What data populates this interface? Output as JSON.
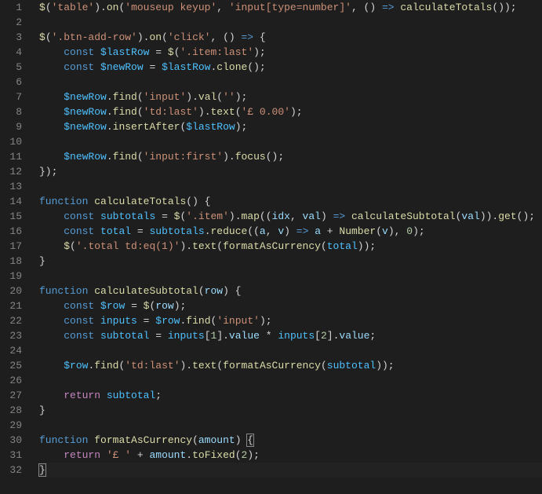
{
  "lines": [
    {
      "n": 1,
      "tokens": [
        {
          "t": "$",
          "c": "tok-call"
        },
        {
          "t": "(",
          "c": "tok-punc"
        },
        {
          "t": "'table'",
          "c": "tok-str"
        },
        {
          "t": ").",
          "c": "tok-punc"
        },
        {
          "t": "on",
          "c": "tok-call"
        },
        {
          "t": "(",
          "c": "tok-punc"
        },
        {
          "t": "'mouseup keyup'",
          "c": "tok-str"
        },
        {
          "t": ", ",
          "c": "tok-punc"
        },
        {
          "t": "'input[type=number]'",
          "c": "tok-str"
        },
        {
          "t": ", () ",
          "c": "tok-punc"
        },
        {
          "t": "=>",
          "c": "tok-kw"
        },
        {
          "t": " ",
          "c": "tok-punc"
        },
        {
          "t": "calculateTotals",
          "c": "tok-call"
        },
        {
          "t": "());",
          "c": "tok-punc"
        }
      ]
    },
    {
      "n": 2,
      "tokens": []
    },
    {
      "n": 3,
      "tokens": [
        {
          "t": "$",
          "c": "tok-call"
        },
        {
          "t": "(",
          "c": "tok-punc"
        },
        {
          "t": "'.btn-add-row'",
          "c": "tok-str"
        },
        {
          "t": ").",
          "c": "tok-punc"
        },
        {
          "t": "on",
          "c": "tok-call"
        },
        {
          "t": "(",
          "c": "tok-punc"
        },
        {
          "t": "'click'",
          "c": "tok-str"
        },
        {
          "t": ", () ",
          "c": "tok-punc"
        },
        {
          "t": "=>",
          "c": "tok-kw"
        },
        {
          "t": " {",
          "c": "tok-punc"
        }
      ]
    },
    {
      "n": 4,
      "tokens": [
        {
          "t": "    ",
          "c": "tok-punc"
        },
        {
          "t": "const",
          "c": "tok-kw"
        },
        {
          "t": " ",
          "c": "tok-punc"
        },
        {
          "t": "$lastRow",
          "c": "tok-const"
        },
        {
          "t": " = ",
          "c": "tok-punc"
        },
        {
          "t": "$",
          "c": "tok-call"
        },
        {
          "t": "(",
          "c": "tok-punc"
        },
        {
          "t": "'.item:last'",
          "c": "tok-str"
        },
        {
          "t": ");",
          "c": "tok-punc"
        }
      ]
    },
    {
      "n": 5,
      "tokens": [
        {
          "t": "    ",
          "c": "tok-punc"
        },
        {
          "t": "const",
          "c": "tok-kw"
        },
        {
          "t": " ",
          "c": "tok-punc"
        },
        {
          "t": "$newRow",
          "c": "tok-const"
        },
        {
          "t": " = ",
          "c": "tok-punc"
        },
        {
          "t": "$lastRow",
          "c": "tok-const"
        },
        {
          "t": ".",
          "c": "tok-punc"
        },
        {
          "t": "clone",
          "c": "tok-call"
        },
        {
          "t": "();",
          "c": "tok-punc"
        }
      ]
    },
    {
      "n": 6,
      "tokens": []
    },
    {
      "n": 7,
      "tokens": [
        {
          "t": "    ",
          "c": "tok-punc"
        },
        {
          "t": "$newRow",
          "c": "tok-const"
        },
        {
          "t": ".",
          "c": "tok-punc"
        },
        {
          "t": "find",
          "c": "tok-call"
        },
        {
          "t": "(",
          "c": "tok-punc"
        },
        {
          "t": "'input'",
          "c": "tok-str"
        },
        {
          "t": ").",
          "c": "tok-punc"
        },
        {
          "t": "val",
          "c": "tok-call"
        },
        {
          "t": "(",
          "c": "tok-punc"
        },
        {
          "t": "''",
          "c": "tok-str"
        },
        {
          "t": ");",
          "c": "tok-punc"
        }
      ]
    },
    {
      "n": 8,
      "tokens": [
        {
          "t": "    ",
          "c": "tok-punc"
        },
        {
          "t": "$newRow",
          "c": "tok-const"
        },
        {
          "t": ".",
          "c": "tok-punc"
        },
        {
          "t": "find",
          "c": "tok-call"
        },
        {
          "t": "(",
          "c": "tok-punc"
        },
        {
          "t": "'td:last'",
          "c": "tok-str"
        },
        {
          "t": ").",
          "c": "tok-punc"
        },
        {
          "t": "text",
          "c": "tok-call"
        },
        {
          "t": "(",
          "c": "tok-punc"
        },
        {
          "t": "'£ 0.00'",
          "c": "tok-str"
        },
        {
          "t": ");",
          "c": "tok-punc"
        }
      ]
    },
    {
      "n": 9,
      "tokens": [
        {
          "t": "    ",
          "c": "tok-punc"
        },
        {
          "t": "$newRow",
          "c": "tok-const"
        },
        {
          "t": ".",
          "c": "tok-punc"
        },
        {
          "t": "insertAfter",
          "c": "tok-call"
        },
        {
          "t": "(",
          "c": "tok-punc"
        },
        {
          "t": "$lastRow",
          "c": "tok-const"
        },
        {
          "t": ");",
          "c": "tok-punc"
        }
      ]
    },
    {
      "n": 10,
      "tokens": []
    },
    {
      "n": 11,
      "tokens": [
        {
          "t": "    ",
          "c": "tok-punc"
        },
        {
          "t": "$newRow",
          "c": "tok-const"
        },
        {
          "t": ".",
          "c": "tok-punc"
        },
        {
          "t": "find",
          "c": "tok-call"
        },
        {
          "t": "(",
          "c": "tok-punc"
        },
        {
          "t": "'input:first'",
          "c": "tok-str"
        },
        {
          "t": ").",
          "c": "tok-punc"
        },
        {
          "t": "focus",
          "c": "tok-call"
        },
        {
          "t": "();",
          "c": "tok-punc"
        }
      ]
    },
    {
      "n": 12,
      "tokens": [
        {
          "t": "});",
          "c": "tok-punc"
        }
      ]
    },
    {
      "n": 13,
      "tokens": []
    },
    {
      "n": 14,
      "tokens": [
        {
          "t": "function",
          "c": "tok-kw"
        },
        {
          "t": " ",
          "c": "tok-punc"
        },
        {
          "t": "calculateTotals",
          "c": "tok-fn"
        },
        {
          "t": "() {",
          "c": "tok-punc"
        }
      ]
    },
    {
      "n": 15,
      "tokens": [
        {
          "t": "    ",
          "c": "tok-punc"
        },
        {
          "t": "const",
          "c": "tok-kw"
        },
        {
          "t": " ",
          "c": "tok-punc"
        },
        {
          "t": "subtotals",
          "c": "tok-const"
        },
        {
          "t": " = ",
          "c": "tok-punc"
        },
        {
          "t": "$",
          "c": "tok-call"
        },
        {
          "t": "(",
          "c": "tok-punc"
        },
        {
          "t": "'.item'",
          "c": "tok-str"
        },
        {
          "t": ").",
          "c": "tok-punc"
        },
        {
          "t": "map",
          "c": "tok-call"
        },
        {
          "t": "((",
          "c": "tok-punc"
        },
        {
          "t": "idx",
          "c": "tok-param"
        },
        {
          "t": ", ",
          "c": "tok-punc"
        },
        {
          "t": "val",
          "c": "tok-param"
        },
        {
          "t": ") ",
          "c": "tok-punc"
        },
        {
          "t": "=>",
          "c": "tok-kw"
        },
        {
          "t": " ",
          "c": "tok-punc"
        },
        {
          "t": "calculateSubtotal",
          "c": "tok-call"
        },
        {
          "t": "(",
          "c": "tok-punc"
        },
        {
          "t": "val",
          "c": "tok-var"
        },
        {
          "t": ")).",
          "c": "tok-punc"
        },
        {
          "t": "get",
          "c": "tok-call"
        },
        {
          "t": "();",
          "c": "tok-punc"
        }
      ]
    },
    {
      "n": 16,
      "tokens": [
        {
          "t": "    ",
          "c": "tok-punc"
        },
        {
          "t": "const",
          "c": "tok-kw"
        },
        {
          "t": " ",
          "c": "tok-punc"
        },
        {
          "t": "total",
          "c": "tok-const"
        },
        {
          "t": " = ",
          "c": "tok-punc"
        },
        {
          "t": "subtotals",
          "c": "tok-const"
        },
        {
          "t": ".",
          "c": "tok-punc"
        },
        {
          "t": "reduce",
          "c": "tok-call"
        },
        {
          "t": "((",
          "c": "tok-punc"
        },
        {
          "t": "a",
          "c": "tok-param"
        },
        {
          "t": ", ",
          "c": "tok-punc"
        },
        {
          "t": "v",
          "c": "tok-param"
        },
        {
          "t": ") ",
          "c": "tok-punc"
        },
        {
          "t": "=>",
          "c": "tok-kw"
        },
        {
          "t": " ",
          "c": "tok-punc"
        },
        {
          "t": "a",
          "c": "tok-var"
        },
        {
          "t": " + ",
          "c": "tok-punc"
        },
        {
          "t": "Number",
          "c": "tok-call"
        },
        {
          "t": "(",
          "c": "tok-punc"
        },
        {
          "t": "v",
          "c": "tok-var"
        },
        {
          "t": "), ",
          "c": "tok-punc"
        },
        {
          "t": "0",
          "c": "tok-num"
        },
        {
          "t": ");",
          "c": "tok-punc"
        }
      ]
    },
    {
      "n": 17,
      "tokens": [
        {
          "t": "    ",
          "c": "tok-punc"
        },
        {
          "t": "$",
          "c": "tok-call"
        },
        {
          "t": "(",
          "c": "tok-punc"
        },
        {
          "t": "'.total td:eq(1)'",
          "c": "tok-str"
        },
        {
          "t": ").",
          "c": "tok-punc"
        },
        {
          "t": "text",
          "c": "tok-call"
        },
        {
          "t": "(",
          "c": "tok-punc"
        },
        {
          "t": "formatAsCurrency",
          "c": "tok-call"
        },
        {
          "t": "(",
          "c": "tok-punc"
        },
        {
          "t": "total",
          "c": "tok-const"
        },
        {
          "t": "));",
          "c": "tok-punc"
        }
      ]
    },
    {
      "n": 18,
      "tokens": [
        {
          "t": "}",
          "c": "tok-punc"
        }
      ]
    },
    {
      "n": 19,
      "tokens": []
    },
    {
      "n": 20,
      "tokens": [
        {
          "t": "function",
          "c": "tok-kw"
        },
        {
          "t": " ",
          "c": "tok-punc"
        },
        {
          "t": "calculateSubtotal",
          "c": "tok-fn"
        },
        {
          "t": "(",
          "c": "tok-punc"
        },
        {
          "t": "row",
          "c": "tok-param"
        },
        {
          "t": ") {",
          "c": "tok-punc"
        }
      ]
    },
    {
      "n": 21,
      "tokens": [
        {
          "t": "    ",
          "c": "tok-punc"
        },
        {
          "t": "const",
          "c": "tok-kw"
        },
        {
          "t": " ",
          "c": "tok-punc"
        },
        {
          "t": "$row",
          "c": "tok-const"
        },
        {
          "t": " = ",
          "c": "tok-punc"
        },
        {
          "t": "$",
          "c": "tok-call"
        },
        {
          "t": "(",
          "c": "tok-punc"
        },
        {
          "t": "row",
          "c": "tok-var"
        },
        {
          "t": ");",
          "c": "tok-punc"
        }
      ]
    },
    {
      "n": 22,
      "tokens": [
        {
          "t": "    ",
          "c": "tok-punc"
        },
        {
          "t": "const",
          "c": "tok-kw"
        },
        {
          "t": " ",
          "c": "tok-punc"
        },
        {
          "t": "inputs",
          "c": "tok-const"
        },
        {
          "t": " = ",
          "c": "tok-punc"
        },
        {
          "t": "$row",
          "c": "tok-const"
        },
        {
          "t": ".",
          "c": "tok-punc"
        },
        {
          "t": "find",
          "c": "tok-call"
        },
        {
          "t": "(",
          "c": "tok-punc"
        },
        {
          "t": "'input'",
          "c": "tok-str"
        },
        {
          "t": ");",
          "c": "tok-punc"
        }
      ]
    },
    {
      "n": 23,
      "tokens": [
        {
          "t": "    ",
          "c": "tok-punc"
        },
        {
          "t": "const",
          "c": "tok-kw"
        },
        {
          "t": " ",
          "c": "tok-punc"
        },
        {
          "t": "subtotal",
          "c": "tok-const"
        },
        {
          "t": " = ",
          "c": "tok-punc"
        },
        {
          "t": "inputs",
          "c": "tok-const"
        },
        {
          "t": "[",
          "c": "tok-punc"
        },
        {
          "t": "1",
          "c": "tok-num"
        },
        {
          "t": "].",
          "c": "tok-punc"
        },
        {
          "t": "value",
          "c": "tok-var"
        },
        {
          "t": " * ",
          "c": "tok-punc"
        },
        {
          "t": "inputs",
          "c": "tok-const"
        },
        {
          "t": "[",
          "c": "tok-punc"
        },
        {
          "t": "2",
          "c": "tok-num"
        },
        {
          "t": "].",
          "c": "tok-punc"
        },
        {
          "t": "value",
          "c": "tok-var"
        },
        {
          "t": ";",
          "c": "tok-punc"
        }
      ]
    },
    {
      "n": 24,
      "tokens": []
    },
    {
      "n": 25,
      "tokens": [
        {
          "t": "    ",
          "c": "tok-punc"
        },
        {
          "t": "$row",
          "c": "tok-const"
        },
        {
          "t": ".",
          "c": "tok-punc"
        },
        {
          "t": "find",
          "c": "tok-call"
        },
        {
          "t": "(",
          "c": "tok-punc"
        },
        {
          "t": "'td:last'",
          "c": "tok-str"
        },
        {
          "t": ").",
          "c": "tok-punc"
        },
        {
          "t": "text",
          "c": "tok-call"
        },
        {
          "t": "(",
          "c": "tok-punc"
        },
        {
          "t": "formatAsCurrency",
          "c": "tok-call"
        },
        {
          "t": "(",
          "c": "tok-punc"
        },
        {
          "t": "subtotal",
          "c": "tok-const"
        },
        {
          "t": "));",
          "c": "tok-punc"
        }
      ]
    },
    {
      "n": 26,
      "tokens": []
    },
    {
      "n": 27,
      "tokens": [
        {
          "t": "    ",
          "c": "tok-punc"
        },
        {
          "t": "return",
          "c": "tok-kw2"
        },
        {
          "t": " ",
          "c": "tok-punc"
        },
        {
          "t": "subtotal",
          "c": "tok-const"
        },
        {
          "t": ";",
          "c": "tok-punc"
        }
      ]
    },
    {
      "n": 28,
      "tokens": [
        {
          "t": "}",
          "c": "tok-punc"
        }
      ]
    },
    {
      "n": 29,
      "tokens": []
    },
    {
      "n": 30,
      "tokens": [
        {
          "t": "function",
          "c": "tok-kw"
        },
        {
          "t": " ",
          "c": "tok-punc"
        },
        {
          "t": "formatAsCurrency",
          "c": "tok-fn"
        },
        {
          "t": "(",
          "c": "tok-punc"
        },
        {
          "t": "amount",
          "c": "tok-param"
        },
        {
          "t": ") ",
          "c": "tok-punc"
        },
        {
          "t": "{",
          "c": "tok-punc",
          "bm": true
        }
      ]
    },
    {
      "n": 31,
      "tokens": [
        {
          "t": "    ",
          "c": "tok-punc"
        },
        {
          "t": "return",
          "c": "tok-kw2"
        },
        {
          "t": " ",
          "c": "tok-punc"
        },
        {
          "t": "'£ '",
          "c": "tok-str"
        },
        {
          "t": " + ",
          "c": "tok-punc"
        },
        {
          "t": "amount",
          "c": "tok-var"
        },
        {
          "t": ".",
          "c": "tok-punc"
        },
        {
          "t": "toFixed",
          "c": "tok-call"
        },
        {
          "t": "(",
          "c": "tok-punc"
        },
        {
          "t": "2",
          "c": "tok-num"
        },
        {
          "t": ");",
          "c": "tok-punc"
        }
      ]
    },
    {
      "n": 32,
      "tokens": [
        {
          "t": "}",
          "c": "tok-punc",
          "bm": true
        },
        {
          "t": "",
          "c": "",
          "caret": true
        }
      ],
      "hl": true
    }
  ]
}
